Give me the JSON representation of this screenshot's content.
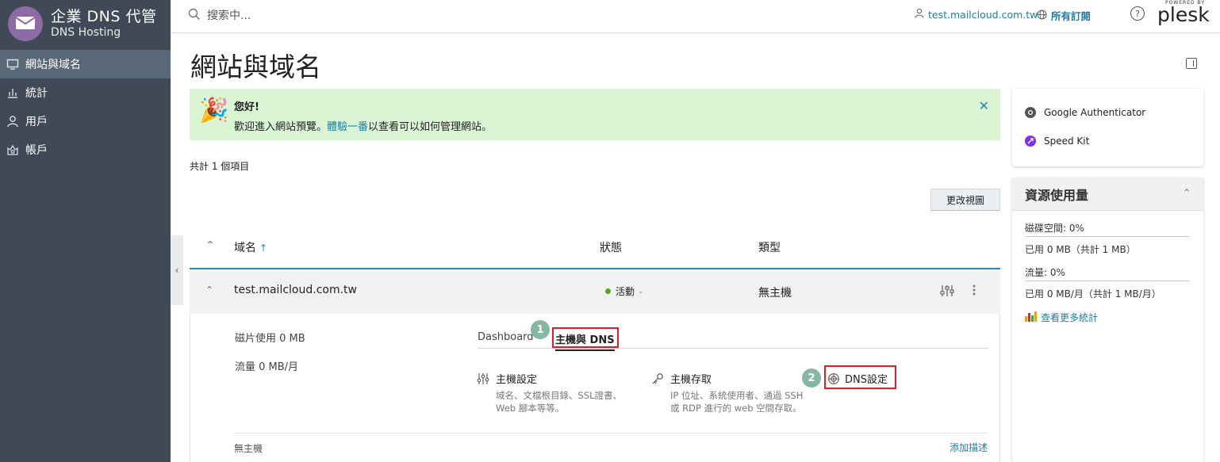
{
  "sidebar": {
    "brand_title": "企業 DNS 代管",
    "brand_subtitle": "DNS Hosting",
    "items": [
      {
        "label": "網站與域名",
        "icon": "monitor-icon",
        "active": true
      },
      {
        "label": "統計",
        "icon": "bar-chart-icon"
      },
      {
        "label": "用戶",
        "icon": "user-icon"
      },
      {
        "label": "帳戶",
        "icon": "account-icon"
      }
    ]
  },
  "topbar": {
    "search_placeholder": "搜索中...",
    "user_label": "test.mailcloud.com.tw",
    "subscriptions_label": "所有訂閱",
    "help_label": "?",
    "powered_by": "POWERED BY",
    "plesk_logo": "plesk"
  },
  "page": {
    "title": "網站與域名"
  },
  "banner": {
    "title": "您好!",
    "text_before": "歡迎進入網站預覽。",
    "link_text": "體驗一番",
    "text_after": "以查看可以如何管理網站。",
    "close": "✕"
  },
  "list": {
    "count_text": "共計 1 個項目",
    "change_view_label": "更改視圖",
    "columns": {
      "domain": "域名",
      "sort_arrow": "↑",
      "status": "狀態",
      "type": "類型"
    },
    "rows": [
      {
        "domain": "test.mailcloud.com.tw",
        "status": "活動",
        "type": "無主機"
      }
    ]
  },
  "details": {
    "disk_usage": "磁片使用 0 MB",
    "traffic": "流量 0 MB/月",
    "tabs": [
      "Dashboard",
      "主機與 DNS"
    ],
    "badge1": "1",
    "badge2": "2",
    "tools": [
      {
        "title": "主機設定",
        "desc1": "域名、文檔根目錄、SSL證書、",
        "desc2": "Web 腳本等等。"
      },
      {
        "title": "主機存取",
        "desc1": "IP 位址、系統使用者、通過 SSH",
        "desc2": "或 RDP 進行的 web 空間存取。"
      },
      {
        "title": "DNS設定"
      }
    ],
    "footer_left": "無主機",
    "footer_right": "添加描述"
  },
  "extensions": [
    {
      "label": "Google Authenticator",
      "color": "#555555"
    },
    {
      "label": "Speed Kit",
      "color": "#7b2ff7"
    }
  ],
  "resources": {
    "title": "資源使用量",
    "disk_label": "磁碟空間: 0%",
    "disk_used": "已用 0 MB（共計 1 MB）",
    "disk_fraction": 0,
    "traffic_label": "流量: 0%",
    "traffic_used": "已用 0 MB/月（共計 1 MB/月）",
    "traffic_fraction": 0,
    "more_stats": "查看更多統計"
  },
  "colors": {
    "sidebar_bg": "#3f4a56",
    "accent": "#1f7da4",
    "banner_bg": "#d9f5d4",
    "highlight_red": "#e21d2a",
    "status_green": "#58a51c"
  }
}
